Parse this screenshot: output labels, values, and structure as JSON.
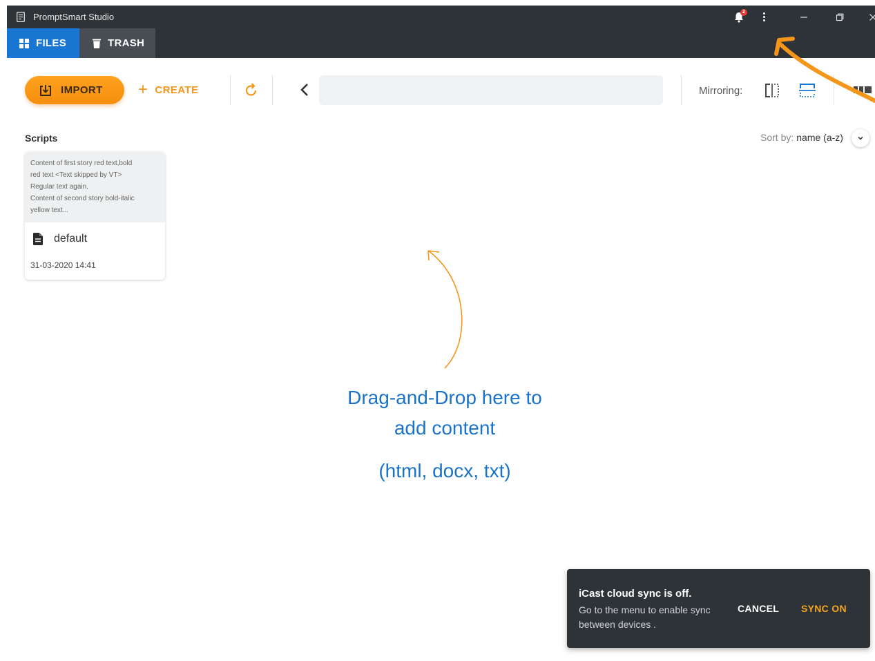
{
  "window": {
    "title": "PromptSmart Studio",
    "notification_count": "2"
  },
  "tabs": [
    {
      "label": "FILES",
      "icon": "grid-icon",
      "active": true
    },
    {
      "label": "TRASH",
      "icon": "trash-icon",
      "active": false
    }
  ],
  "toolbar": {
    "import_label": "IMPORT",
    "create_label": "CREATE",
    "path_value": "",
    "mirroring_label": "Mirroring:"
  },
  "content": {
    "section_title": "Scripts",
    "sort_prefix": "Sort by:",
    "sort_value": "name (a-z)"
  },
  "scripts": [
    {
      "preview_lines": [
        "Content of first story red text,bold",
        "red text <Text skipped by VT>",
        "Regular text again.",
        "Content of second story bold-italic",
        "yellow text..."
      ],
      "name": "default",
      "date": "31-03-2020 14:41"
    }
  ],
  "drop_hint": {
    "line1": "Drag-and-Drop here to",
    "line2": "add content",
    "formats": "(html, docx, txt)"
  },
  "snackbar": {
    "title": "iCast cloud sync is off.",
    "message": "Go to the menu to enable sync between devices .",
    "cancel_label": "CANCEL",
    "confirm_label": "SYNC ON"
  },
  "colors": {
    "titlebar": "#2e3338",
    "active_tab": "#1976d2",
    "accent_orange": "#f5961b",
    "hint_blue": "#1a73c8"
  }
}
